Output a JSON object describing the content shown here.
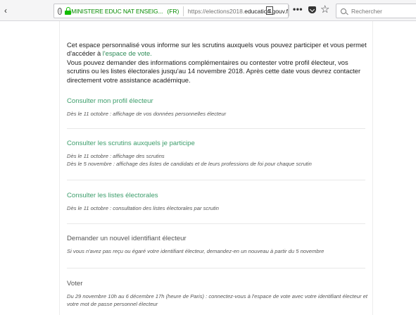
{
  "browser": {
    "site_name": "MINISTERE EDUC NAT ENSEIG...",
    "site_country": "(FR)",
    "url_prefix": "https://elections2018.",
    "url_domain": "education.gouv.f",
    "more_label": "•••",
    "search_placeholder": "Rechercher",
    "icons": [
      "info-icon",
      "lock-icon",
      "reader-view-icon",
      "more-icon",
      "pocket-icon",
      "bookmark-star-icon",
      "search-icon"
    ]
  },
  "intro": {
    "line1": "Cet espace personnalisé vous informe sur les scrutins auxquels vous pouvez participer et vous permet d'accéder à ",
    "link": "l'espace de vote.",
    "line2": "Vous pouvez demander des informations complémentaires ou contester votre profil électeur, vos scrutins ou les listes électorales jusqu'au 14 novembre 2018. Après cette date vous devrez contacter directement votre assistance académique."
  },
  "sections": [
    {
      "title": "Consulter mon profil électeur",
      "desc": [
        "Dès le 11 octobre : affichage de vos données personnelles électeur"
      ]
    },
    {
      "title": "Consulter les scrutins auxquels je participe",
      "desc": [
        "Dès le 11 octobre : affichage des scrutins",
        "Dès le 5 novembre : affichage des listes de candidats et de leurs professions de foi pour chaque scrutin"
      ]
    },
    {
      "title": "Consulter les listes électorales",
      "desc": [
        "Dès le 11 octobre : consultation des listes électorales par scrutin"
      ]
    },
    {
      "title": "Demander un nouvel identifiant électeur",
      "desc": [
        "Si vous n'avez pas reçu ou égaré votre identifiant électeur, demandez-en un nouveau à partir du 5 novembre"
      ]
    },
    {
      "title": "Voter",
      "desc": [
        "Du 29 novembre 10h au 6 décembre 17h (heure de Paris) : connectez-vous à l'espace de vote avec votre identifiant électeur et votre mot de passe personnel électeur"
      ]
    }
  ],
  "colors": {
    "link_green": "#3c9d6b",
    "url_green": "#058b00",
    "muted_text": "#555555"
  }
}
